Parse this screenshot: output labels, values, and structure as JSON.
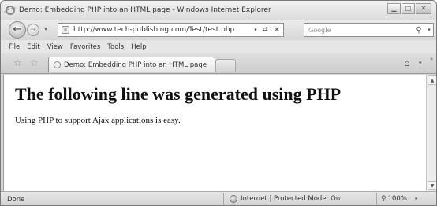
{
  "window": {
    "title": "Demo: Embedding PHP into an HTML page - Windows Internet Explorer"
  },
  "navigation": {
    "url": "http://www.tech-publishing.com/Test/test.php",
    "search_placeholder": "Google"
  },
  "menu": {
    "items": [
      "File",
      "Edit",
      "View",
      "Favorites",
      "Tools",
      "Help"
    ]
  },
  "tabs": {
    "active_label": "Demo: Embedding PHP into an HTML page"
  },
  "page": {
    "heading": "The following line was generated using PHP",
    "text": "Using PHP to support Ajax applications is easy."
  },
  "status": {
    "left": "Done",
    "zone": "Internet | Protected Mode: On",
    "zoom": "100%"
  }
}
